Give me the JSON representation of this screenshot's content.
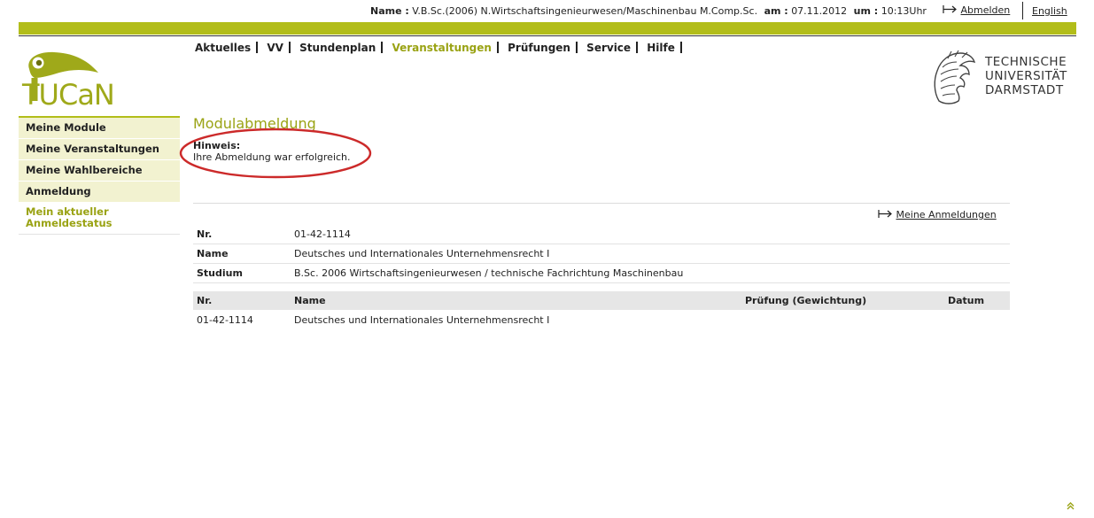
{
  "header": {
    "name_label": "Name :",
    "name_value": "V.B.Sc.(2006) N.Wirtschaftsingenieurwesen/Maschinenbau M.Comp.Sc.",
    "date_label": "am :",
    "date_value": "07.11.2012",
    "time_label": "um :",
    "time_value": "10:13Uhr",
    "logout_label": "Abmelden",
    "language_label": "English"
  },
  "brand": {
    "app_logo_text": "TUCaN",
    "university_lines": [
      "TECHNISCHE",
      "UNIVERSITÄT",
      "DARMSTADT"
    ],
    "accent_color": "#b2bd1a"
  },
  "mainnav": {
    "items": [
      {
        "label": "Aktuelles",
        "active": false
      },
      {
        "label": "VV",
        "active": false
      },
      {
        "label": "Stundenplan",
        "active": false
      },
      {
        "label": "Veranstaltungen",
        "active": true
      },
      {
        "label": "Prüfungen",
        "active": false
      },
      {
        "label": "Service",
        "active": false
      },
      {
        "label": "Hilfe",
        "active": false
      }
    ]
  },
  "sidebar": {
    "items": [
      {
        "label": "Meine Module"
      },
      {
        "label": "Meine Veranstaltungen"
      },
      {
        "label": "Meine Wahlbereiche"
      },
      {
        "label": "Anmeldung"
      }
    ],
    "current_label": "Mein aktueller Anmeldestatus"
  },
  "content": {
    "title": "Modulabmeldung",
    "hint_label": "Hinweis:",
    "hint_text": "Ihre Abmeldung war erfolgreich.",
    "my_registrations_link": "Meine Anmeldungen",
    "info": {
      "nr_label": "Nr.",
      "nr_value": "01-42-1114",
      "name_label": "Name",
      "name_value": "Deutsches und Internationales Unternehmensrecht I",
      "study_label": "Studium",
      "study_value": "B.Sc. 2006 Wirtschaftsingenieurwesen / technische Fachrichtung Maschinenbau"
    },
    "table": {
      "columns": [
        "Nr.",
        "Name",
        "Prüfung (Gewichtung)",
        "Datum"
      ],
      "rows": [
        [
          "01-42-1114",
          "Deutsches und Internationales Unternehmensrecht I",
          "",
          ""
        ]
      ]
    }
  },
  "icons": {
    "logout": "arrow-right-icon",
    "my_registrations": "arrow-right-icon",
    "back_to_top": "chevron-double-up-icon"
  }
}
